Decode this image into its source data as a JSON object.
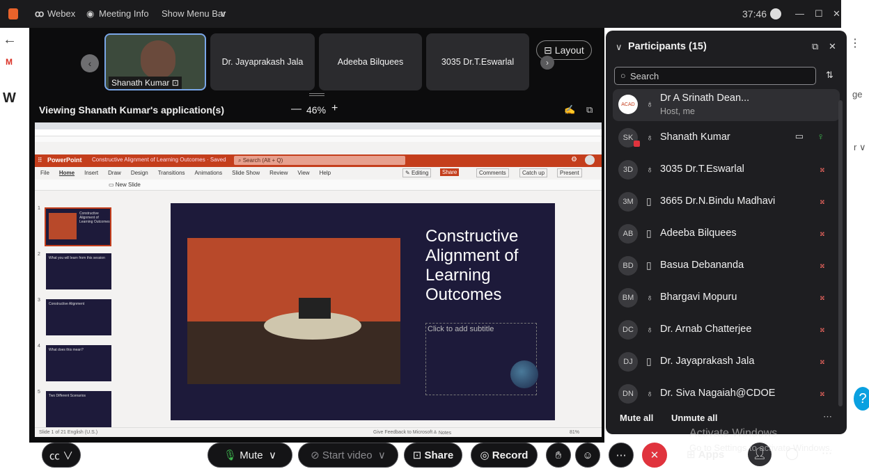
{
  "titlebar": {
    "app": "Webex",
    "meeting_info": "Meeting Info",
    "show_menu_bar": "Show Menu Bar",
    "timer": "37:46"
  },
  "filmstrip": {
    "items": [
      {
        "name": "Shanath Kumar"
      },
      {
        "name": "Dr. Jayaprakash Jala"
      },
      {
        "name": "Adeeba Bilquees"
      },
      {
        "name": "3035 Dr.T.Eswarlal"
      }
    ],
    "layout_label": "Layout"
  },
  "share_bar": {
    "viewing": "Viewing Shanath Kumar's application(s)",
    "zoom": "46%"
  },
  "ppt": {
    "app_name": "PowerPoint",
    "doc_title": "Constructive Alignment of Learning Outcomes · Saved",
    "search_placeholder": "Search (Alt + Q)",
    "tabs": [
      "File",
      "Home",
      "Insert",
      "Draw",
      "Design",
      "Transitions",
      "Animations",
      "Slide Show",
      "Review",
      "View",
      "Help"
    ],
    "editing": "Editing",
    "share": "Share",
    "comments": "Comments",
    "catch_up": "Catch up",
    "present": "Present",
    "new_slide": "New Slide",
    "slide_title": "Constructive Alignment of Learning Outcomes",
    "subtitle_placeholder": "Click to add subtitle",
    "status_left": "Slide 1 of 21   English (U.S.)",
    "status_feedback": "Give Feedback to Microsoft",
    "status_notes": "Notes",
    "status_zoom": "81%",
    "thumbnails": [
      {
        "num": "1",
        "text": "Constructive Alignment of Learning Outcomes"
      },
      {
        "num": "2",
        "text": "What you will learn from this session"
      },
      {
        "num": "3",
        "text": "Constructive Alignment"
      },
      {
        "num": "4",
        "text": "What does this mean?"
      },
      {
        "num": "5",
        "text": "Two Different Scenarios"
      }
    ]
  },
  "panel": {
    "title": "Participants (15)",
    "search_placeholder": "Search",
    "participants": [
      {
        "initials": "",
        "name": "Dr A Srinath Dean...",
        "sub": "Host, me",
        "device": "headset",
        "muted": false
      },
      {
        "initials": "SK",
        "name": "Shanath Kumar",
        "sub": "",
        "device": "headset",
        "muted": false
      },
      {
        "initials": "3D",
        "name": "3035 Dr.T.Eswarlal",
        "sub": "",
        "device": "headset",
        "muted": true
      },
      {
        "initials": "3M",
        "name": "3665 Dr.N.Bindu Madhavi",
        "sub": "",
        "device": "mobile",
        "muted": true
      },
      {
        "initials": "AB",
        "name": "Adeeba Bilquees",
        "sub": "",
        "device": "mobile",
        "muted": true
      },
      {
        "initials": "BD",
        "name": "Basua Debananda",
        "sub": "",
        "device": "mobile",
        "muted": true
      },
      {
        "initials": "BM",
        "name": "Bhargavi Mopuru",
        "sub": "",
        "device": "headset",
        "muted": true
      },
      {
        "initials": "DC",
        "name": "Dr. Arnab Chatterjee",
        "sub": "",
        "device": "headset",
        "muted": true
      },
      {
        "initials": "DJ",
        "name": "Dr. Jayaprakash Jala",
        "sub": "",
        "device": "mobile",
        "muted": true
      },
      {
        "initials": "DN",
        "name": "Dr. Siva Nagaiah@CDOE",
        "sub": "",
        "device": "headset",
        "muted": true
      }
    ],
    "mute_all": "Mute all",
    "unmute_all": "Unmute all"
  },
  "controls": {
    "mute": "Mute",
    "start_video": "Start video",
    "share": "Share",
    "record": "Record",
    "apps": "Apps"
  },
  "watermark": {
    "line1": "Activate Windows",
    "line2": "Go to Settings to activate Windows."
  },
  "colors": {
    "ppt_red": "#c43e1c",
    "slide_bg": "#1d1a3a",
    "end_red": "#e0333d",
    "mute_red": "#e0605a"
  }
}
